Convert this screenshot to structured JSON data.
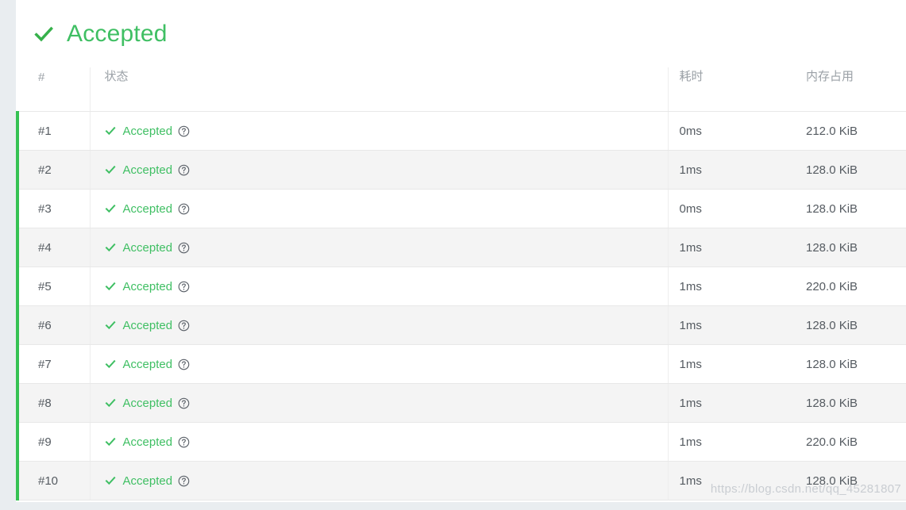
{
  "verdict": {
    "icon": "check-icon",
    "title": "Accepted",
    "color": "#3fbf63"
  },
  "table": {
    "columns": [
      {
        "key": "index",
        "label": "#"
      },
      {
        "key": "status",
        "label": "状态"
      },
      {
        "key": "time",
        "label": "耗时"
      },
      {
        "key": "memory",
        "label": "内存占用"
      }
    ],
    "status_icon": "check-icon",
    "help_icon": "question-circle-icon",
    "accent_color": "#35c253",
    "status_color": "#3fbf63",
    "rows": [
      {
        "index": "#1",
        "status": "Accepted",
        "time": "0ms",
        "memory": "212.0 KiB"
      },
      {
        "index": "#2",
        "status": "Accepted",
        "time": "1ms",
        "memory": "128.0 KiB"
      },
      {
        "index": "#3",
        "status": "Accepted",
        "time": "0ms",
        "memory": "128.0 KiB"
      },
      {
        "index": "#4",
        "status": "Accepted",
        "time": "1ms",
        "memory": "128.0 KiB"
      },
      {
        "index": "#5",
        "status": "Accepted",
        "time": "1ms",
        "memory": "220.0 KiB"
      },
      {
        "index": "#6",
        "status": "Accepted",
        "time": "1ms",
        "memory": "128.0 KiB"
      },
      {
        "index": "#7",
        "status": "Accepted",
        "time": "1ms",
        "memory": "128.0 KiB"
      },
      {
        "index": "#8",
        "status": "Accepted",
        "time": "1ms",
        "memory": "128.0 KiB"
      },
      {
        "index": "#9",
        "status": "Accepted",
        "time": "1ms",
        "memory": "220.0 KiB"
      },
      {
        "index": "#10",
        "status": "Accepted",
        "time": "1ms",
        "memory": "128.0 KiB"
      }
    ]
  },
  "watermark": "https://blog.csdn.net/qq_45281807"
}
